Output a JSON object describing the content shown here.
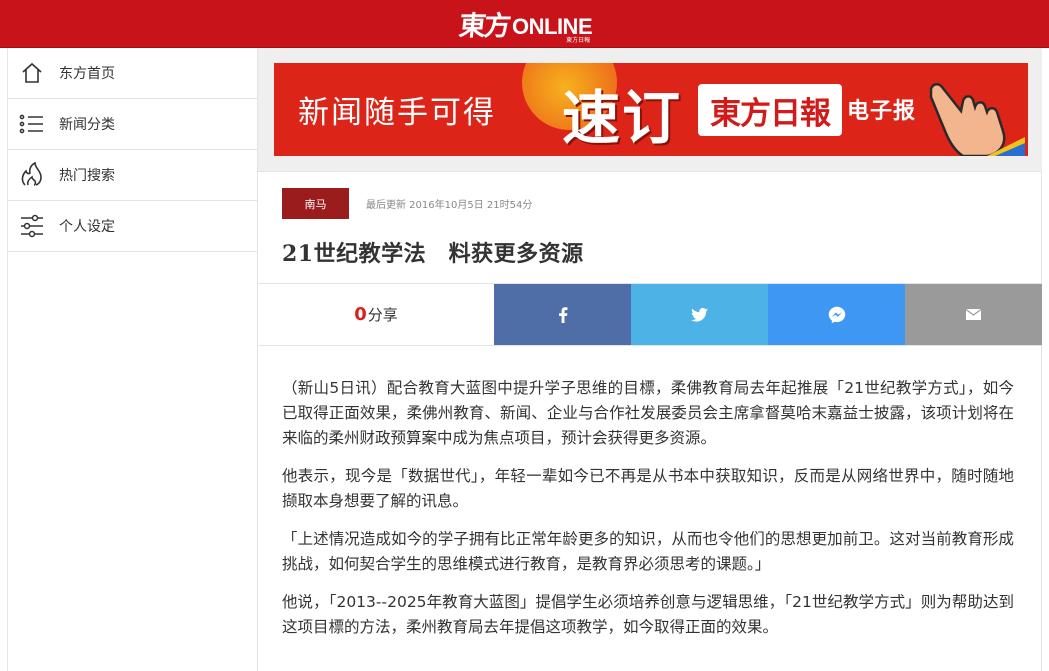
{
  "header": {
    "logo_cn": "東方",
    "logo_en": "ONLINE",
    "logo_sub": "東方日報"
  },
  "sidebar": {
    "items": [
      {
        "label": "东方首页",
        "icon": "home-icon"
      },
      {
        "label": "新闻分类",
        "icon": "list-icon"
      },
      {
        "label": "热门搜索",
        "icon": "fire-icon"
      },
      {
        "label": "个人设定",
        "icon": "sliders-icon"
      }
    ]
  },
  "banner": {
    "left_text": "新闻随手可得",
    "big_text": "速订",
    "paper_name": "東方日報",
    "epaper_text": "电子报"
  },
  "article": {
    "tag": "南马",
    "updated": "最后更新 2016年10月5日 21时54分",
    "title": "21世纪教学法　料获更多资源",
    "paragraphs": [
      "（新山5日讯）配合教育大蓝图中提升学子思维的目標，柔佛教育局去年起推展「21世纪教学方式」，如今已取得正面效果，柔佛州教育、新闻、企业与合作社发展委员会主席拿督莫哈末嘉益士披露，该项计划将在来临的柔州财政预算案中成为焦点项目，预计会获得更多资源。",
      "他表示，现今是「数据世代」，年轻一辈如今已不再是从书本中获取知识，反而是从网络世界中，随时随地撷取本身想要了解的讯息。",
      "「上述情况造成如今的学子拥有比正常年龄更多的知识，从而也令他们的思想更加前卫。这对当前教育形成挑战，如何契合学生的思维模式进行教育，是教育界必须思考的课题。」",
      "他说，「2013--2025年教育大蓝图」提倡学生必须培养创意与逻辑思维，「21世纪教学方式」则为帮助达到这项目標的方法，柔州教育局去年提倡这项教学，如今取得正面的效果。"
    ]
  },
  "share": {
    "count": "0",
    "label": "分享",
    "buttons": [
      {
        "name": "facebook",
        "icon": "facebook-icon"
      },
      {
        "name": "twitter",
        "icon": "twitter-icon"
      },
      {
        "name": "messenger",
        "icon": "messenger-icon"
      },
      {
        "name": "email",
        "icon": "email-icon"
      }
    ]
  },
  "colors": {
    "brand_red": "#c9131b",
    "tag_red": "#9b1c1c",
    "facebook": "#4f6ea8",
    "twitter": "#4db2e6",
    "messenger": "#3d97f3",
    "email": "#9a9a9a"
  }
}
